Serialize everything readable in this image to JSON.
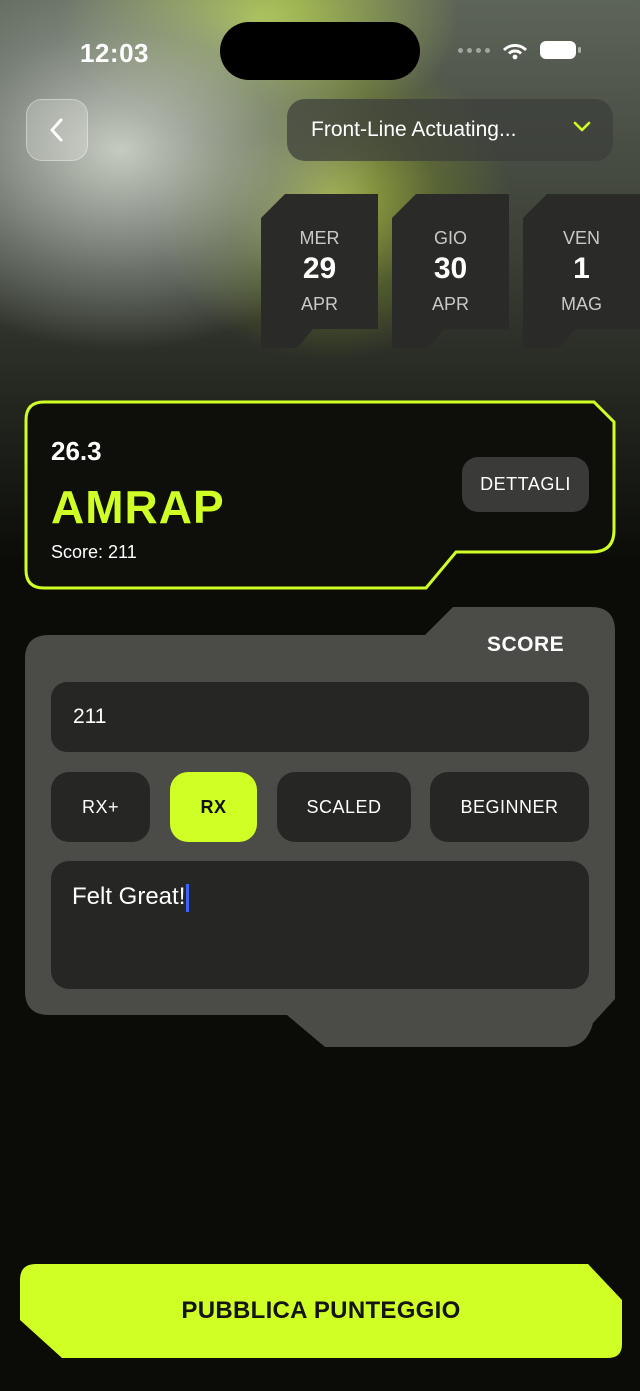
{
  "status_bar": {
    "time": "12:03"
  },
  "header": {
    "affiliate_select": "Front-Line Actuating..."
  },
  "days": [
    {
      "weekday": "MER",
      "day": "29",
      "month": "APR"
    },
    {
      "weekday": "GIO",
      "day": "30",
      "month": "APR"
    },
    {
      "weekday": "VEN",
      "day": "1",
      "month": "MAG"
    }
  ],
  "workout": {
    "code": "26.3",
    "type": "AMRAP",
    "score_text": "Score: 211",
    "details_label": "DETTAGLI"
  },
  "score_panel": {
    "title": "SCORE",
    "score_value": "211",
    "levels": [
      "RX+",
      "RX",
      "SCALED",
      "BEGINNER"
    ],
    "selected_level": "RX",
    "notes_value": "Felt Great!"
  },
  "publish_label": "PUBBLICA PUNTEGGIO",
  "colors": {
    "accent": "#cfff24",
    "panel": "#4b4b47",
    "field": "#262624"
  }
}
